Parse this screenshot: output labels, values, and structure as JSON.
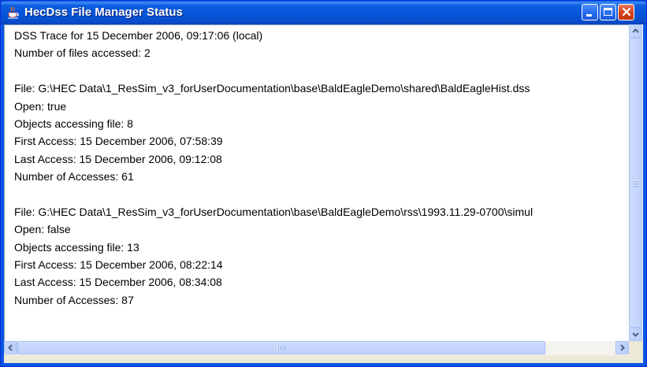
{
  "window": {
    "title": "HecDss File Manager Status",
    "icon": "java-coffee-cup-icon",
    "controls": [
      "minimize-icon",
      "maximize-icon",
      "close-icon"
    ]
  },
  "trace": {
    "lines": [
      "DSS Trace for 15 December 2006, 09:17:06 (local)",
      "Number of files accessed: 2",
      "",
      "File: G:\\HEC Data\\1_ResSim_v3_forUserDocumentation\\base\\BaldEagleDemo\\shared\\BaldEagleHist.dss",
      "Open: true",
      "Objects accessing file: 8",
      "First Access: 15 December 2006, 07:58:39",
      "Last Access:  15 December 2006, 09:12:08",
      "Number of Accesses: 61",
      "",
      "File: G:\\HEC Data\\1_ResSim_v3_forUserDocumentation\\base\\BaldEagleDemo\\rss\\1993.11.29-0700\\simul",
      "Open: false",
      "Objects accessing file: 13",
      "First Access: 15 December 2006, 08:22:14",
      "Last Access:  15 December 2006, 08:34:08",
      "Number of Accesses: 87"
    ]
  },
  "scrollbars": {
    "vertical": {
      "icons": [
        "scroll-up-arrow-icon",
        "scroll-down-arrow-icon"
      ]
    },
    "horizontal": {
      "icons": [
        "scroll-left-arrow-icon",
        "scroll-right-arrow-icon"
      ]
    }
  },
  "colors": {
    "titlebar": "#0554d8",
    "close_button": "#d5431d",
    "client_bg": "#ece9d8",
    "scroll_thumb": "#c3d3fd"
  }
}
